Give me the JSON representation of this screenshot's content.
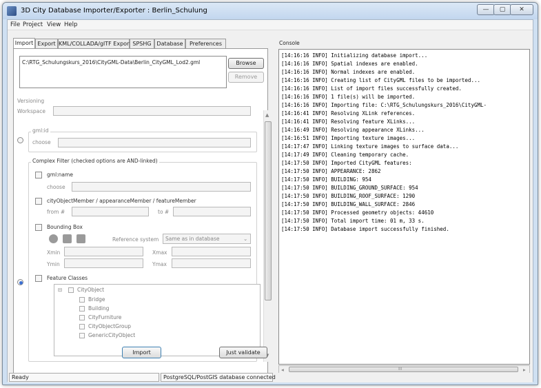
{
  "window": {
    "title": "3D City Database Importer/Exporter : Berlin_Schulung",
    "controls": {
      "minimize": "—",
      "maximize": "▢",
      "close": "✕"
    }
  },
  "menu": [
    "File",
    "Project",
    "View",
    "Help"
  ],
  "tabs": [
    "Import",
    "Export",
    "KML/COLLADA/glTF Export",
    "SPSHG",
    "Database",
    "Preferences"
  ],
  "import": {
    "file_path": "C:\\RTG_Schulungskurs_2016\\CityGML-Data\\Berlin_CityGML_Lod2.gml",
    "browse_label": "Browse",
    "remove_label": "Remove",
    "versioning": {
      "title": "Versioning",
      "workspace_label": "Workspace",
      "workspace_value": ""
    },
    "gmlid": {
      "title": "gml:id",
      "choose_label": "choose",
      "choose_value": ""
    },
    "complex_filter": {
      "title": "Complex Filter (checked options are AND-linked)",
      "gmlname": {
        "label": "gml:name",
        "choose_label": "choose",
        "value": ""
      },
      "member": {
        "label": "cityObjectMember / appearanceMember / featureMember",
        "from_label": "from #",
        "to_label": "to #",
        "from_value": "",
        "to_value": ""
      },
      "bbox": {
        "label": "Bounding Box",
        "reference_label": "Reference system",
        "reference_value": "Same as in database",
        "xmin_label": "Xmin",
        "xmax_label": "Xmax",
        "ymin_label": "Ymin",
        "ymax_label": "Ymax"
      },
      "feature_classes": {
        "label": "Feature Classes",
        "root": "CityObject",
        "items": [
          "Bridge",
          "Building",
          "CityFurniture",
          "CityObjectGroup",
          "GenericCityObject"
        ]
      }
    },
    "import_button": "Import",
    "validate_button": "Just validate"
  },
  "console": {
    "title": "Console",
    "lines": [
      "[14:16:16 INFO] Initializing database import...",
      "[14:16:16 INFO] Spatial indexes are enabled.",
      "[14:16:16 INFO] Normal indexes are enabled.",
      "[14:16:16 INFO] Creating list of CityGML files to be imported...",
      "[14:16:16 INFO] List of import files successfully created.",
      "[14:16:16 INFO] 1 file(s) will be imported.",
      "[14:16:16 INFO] Importing file: C:\\RTG_Schulungskurs_2016\\CityGML-",
      "[14:16:41 INFO] Resolving XLink references.",
      "[14:16:41 INFO] Resolving feature XLinks...",
      "[14:16:49 INFO] Resolving appearance XLinks...",
      "[14:16:51 INFO] Importing texture images...",
      "[14:17:47 INFO] Linking texture images to surface data...",
      "[14:17:49 INFO] Cleaning temporary cache.",
      "[14:17:50 INFO] Imported CityGML features:",
      "[14:17:50 INFO] APPEARANCE: 2862",
      "[14:17:50 INFO] BUILDING: 954",
      "[14:17:50 INFO] BUILDING_GROUND_SURFACE: 954",
      "[14:17:50 INFO] BUILDING_ROOF_SURFACE: 1290",
      "[14:17:50 INFO] BUILDING_WALL_SURFACE: 2846",
      "[14:17:50 INFO] Processed geometry objects: 44610",
      "[14:17:50 INFO] Total import time: 01 m, 33 s.",
      "[14:17:50 INFO] Database import successfully finished."
    ],
    "hscroll_mark": "III"
  },
  "status": {
    "left": "Ready",
    "right": "PostgreSQL/PostGIS database connected"
  }
}
